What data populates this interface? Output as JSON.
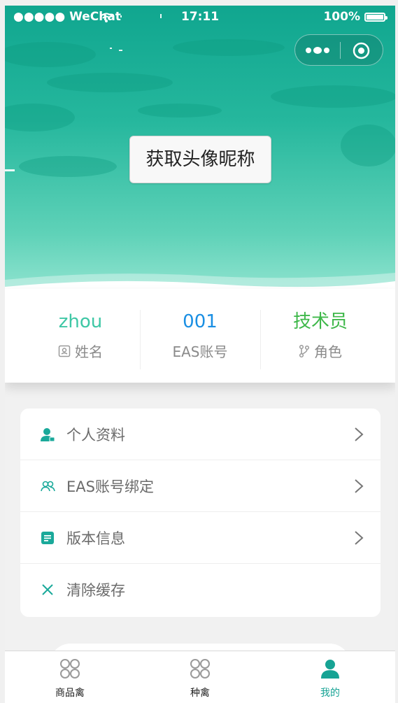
{
  "status_bar": {
    "carrier": "●●●●● WeChat",
    "time": "17:11",
    "battery": "100%"
  },
  "header": {
    "avatar_button": "获取头像昵称"
  },
  "profile": [
    {
      "value": "zhou",
      "label": "姓名",
      "color": "#3ec7a5",
      "icon": "id-card-icon"
    },
    {
      "value": "001",
      "label": "EAS账号",
      "color": "#1a8fe3",
      "icon": ""
    },
    {
      "value": "技术员",
      "label": "角色",
      "color": "#3fb84a",
      "icon": "branch-icon"
    }
  ],
  "menu": [
    {
      "label": "个人资料",
      "icon": "user-icon",
      "chevron": true
    },
    {
      "label": "EAS账号绑定",
      "icon": "users-icon",
      "chevron": true
    },
    {
      "label": "版本信息",
      "icon": "document-icon",
      "chevron": true
    },
    {
      "label": "清除缓存",
      "icon": "close-icon",
      "chevron": false
    }
  ],
  "tabbar": [
    {
      "label": "商品禽",
      "icon": "grid-circles-icon",
      "active": false
    },
    {
      "label": "种禽",
      "icon": "grid-circles-icon",
      "active": false
    },
    {
      "label": "我的",
      "icon": "person-icon",
      "active": true
    }
  ],
  "colors": {
    "accent": "#16a394",
    "header_top": "#10a68f",
    "header_bottom": "#8fe3cf"
  }
}
